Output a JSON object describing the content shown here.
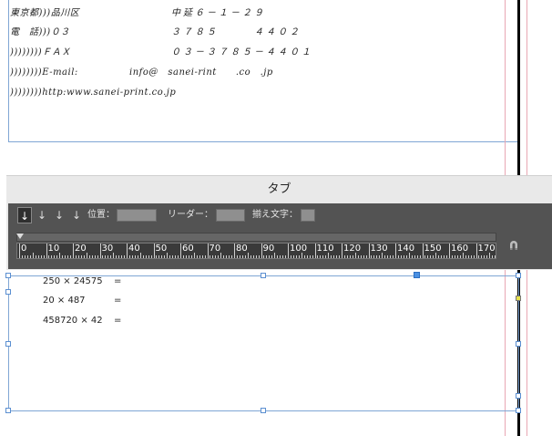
{
  "document": {
    "address_lines": [
      {
        "left": "東京都)))品川区",
        "right": "中延６－１－２９"
      },
      {
        "left": "電　話)))０３",
        "right": "３７８５　　　４４０２"
      },
      {
        "left": "))))))))ＦＡＸ",
        "right": "０３－３７８５－４４０１"
      },
      {
        "left": "))))))))E-mail:",
        "mid": "info@　sanei-rint　　.co　.jp"
      },
      {
        "left": "))))))))http:www.sanei-print.co.jp"
      }
    ],
    "calc_lines": [
      {
        "expr": "250 × 24575",
        "eq": "="
      },
      {
        "expr": "20 × 487",
        "eq": "="
      },
      {
        "expr": "458720 × 42",
        "eq": "="
      }
    ]
  },
  "tabs_panel": {
    "title": "タブ",
    "tab_buttons": [
      "↓",
      "↓",
      "↓",
      "↓"
    ],
    "position_label": "位置：",
    "leader_label": "リーダー：",
    "align_label": "揃え文字：",
    "ruler_labels": [
      "0",
      "10",
      "20",
      "30",
      "40",
      "50",
      "60",
      "70",
      "80",
      "90",
      "100",
      "110",
      "120",
      "130",
      "140",
      "150",
      "160",
      "170"
    ]
  },
  "colors": {
    "frame": "#7fa6d4",
    "panel_dark": "#535353",
    "selected_handle": "#4a90e2"
  },
  "icons": [
    "magnet-icon"
  ]
}
